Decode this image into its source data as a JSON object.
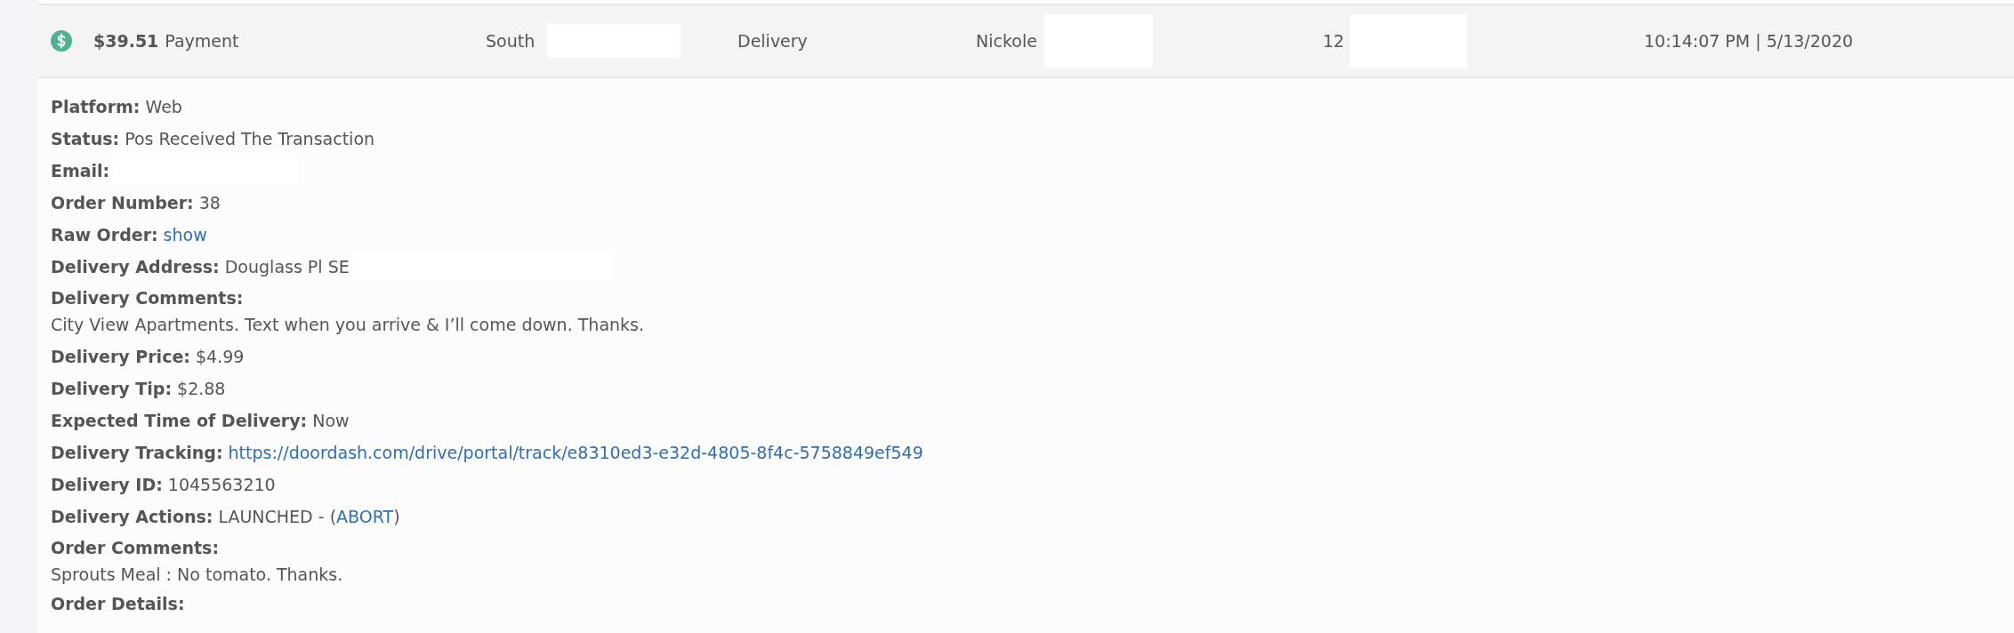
{
  "order_row": {
    "amount": "$39.51",
    "type": "Payment",
    "location": "South",
    "service": "Delivery",
    "customer": "Nickole",
    "phone": "12",
    "time": "10:14:07 PM | 5/13/2020"
  },
  "details": [
    {
      "kind": "plain",
      "label": "Platform:",
      "value": "Web"
    },
    {
      "kind": "plain",
      "label": "Status:",
      "value": "Pos Received The Transaction"
    },
    {
      "kind": "redacted",
      "label": "Email:"
    },
    {
      "kind": "plain",
      "label": "Order Number:",
      "value": "38"
    },
    {
      "kind": "link",
      "label": "Raw Order:",
      "value": "show"
    },
    {
      "kind": "redacted",
      "label": "Delivery Address:",
      "value": "Douglass Pl SE"
    },
    {
      "kind": "block",
      "label": "Delivery Comments:",
      "value": "City View Apartments. Text when you arrive & I’ll come down. Thanks."
    },
    {
      "kind": "plain",
      "label": "Delivery Price:",
      "value": "$4.99"
    },
    {
      "kind": "plain",
      "label": "Delivery Tip:",
      "value": "$2.88"
    },
    {
      "kind": "plain",
      "label": "Expected Time of Delivery:",
      "value": "Now"
    },
    {
      "kind": "link",
      "label": "Delivery Tracking:",
      "value": "https://doordash.com/drive/portal/track/e8310ed3-e32d-4805-8f4c-5758849ef549"
    },
    {
      "kind": "plain",
      "label": "Delivery ID:",
      "value": "1045563210"
    },
    {
      "kind": "action",
      "label": "Delivery Actions:",
      "value": "LAUNCHED - (",
      "link": "ABORT",
      "after": ")"
    },
    {
      "kind": "block",
      "label": "Order Comments:",
      "value": "Sprouts Meal : No tomato. Thanks."
    },
    {
      "kind": "heading",
      "label": "Order Details:"
    }
  ]
}
